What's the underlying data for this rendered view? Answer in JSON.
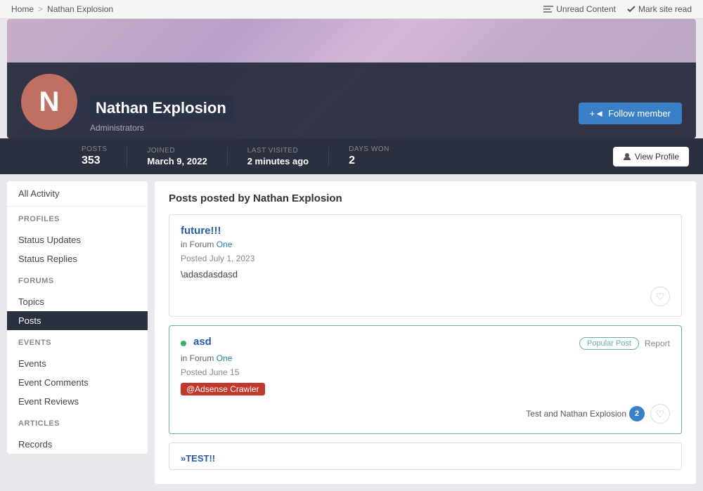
{
  "breadcrumb": {
    "home": "Home",
    "separator": ">",
    "current": "Nathan Explosion"
  },
  "topbar": {
    "unread": "Unread Content",
    "mark_read": "Mark site read"
  },
  "profile": {
    "name": "Nathan Explosion",
    "role": "Administrators",
    "avatar_letter": "N",
    "follow_label": "Follow member",
    "posts_label": "POSTS",
    "posts_value": "353",
    "joined_label": "JOINED",
    "joined_value": "March 9, 2022",
    "last_visited_label": "LAST VISITED",
    "last_visited_value": "2 minutes ago",
    "days_won_label": "DAYS WON",
    "days_won_value": "2",
    "view_profile": "View Profile"
  },
  "sidebar": {
    "all_activity": "All Activity",
    "profiles_title": "PROFILES",
    "status_updates": "Status Updates",
    "status_replies": "Status Replies",
    "forums_title": "FORUMS",
    "topics": "Topics",
    "posts": "Posts",
    "events_title": "EVENTS",
    "events": "Events",
    "event_comments": "Event Comments",
    "event_reviews": "Event Reviews",
    "articles_title": "ARTICLES",
    "records": "Records"
  },
  "content": {
    "title": "Posts posted by Nathan Explosion",
    "posts": [
      {
        "id": 1,
        "title": "future!!!",
        "forum_prefix": "in Forum",
        "forum": "One",
        "date": "Posted July 1, 2023",
        "body": "\\adasdasdasd",
        "popular": false,
        "likes_text": "",
        "likes_count": null
      },
      {
        "id": 2,
        "title": "asd",
        "forum_prefix": "in Forum",
        "forum": "One",
        "date": "Posted June 15",
        "body_mention": "@Adsense Crawler",
        "popular": true,
        "popular_label": "Popular Post",
        "report_label": "Report",
        "likes_text": "Test and Nathan Explosion",
        "likes_count": "2"
      },
      {
        "id": 3,
        "title": "»TEST!!",
        "partial": true
      }
    ]
  }
}
